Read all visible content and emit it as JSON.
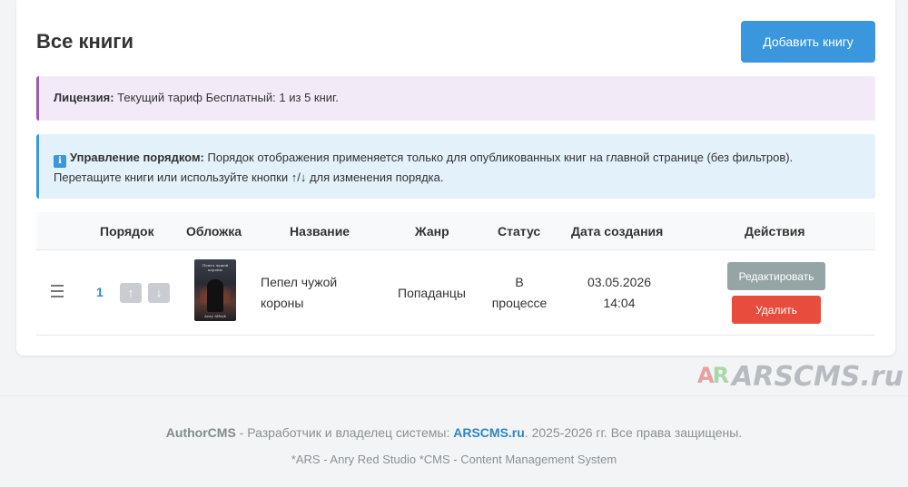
{
  "header": {
    "title": "Все книги",
    "add_button": "Добавить книгу"
  },
  "license": {
    "label": "Лицензия:",
    "text": " Текущий тариф Бесплатный: 1 из 5 книг."
  },
  "order_info": {
    "icon": "i",
    "label": "Управление порядком:",
    "text1": " Порядок отображения применяется только для опубликованных книг на главной странице (без фильтров).",
    "text2": "Перетащите книги или используйте кнопки ↑/↓ для изменения порядка."
  },
  "table": {
    "columns": [
      "Порядок",
      "Обложка",
      "Название",
      "Жанр",
      "Статус",
      "Дата создания",
      "Действия"
    ],
    "rows": [
      {
        "order": "1",
        "up": "↑",
        "down": "↓",
        "cover_caption": "Пепел чужой короны",
        "cover_author": "Аnry Аlfeyk",
        "title_line1": "Пепел чужой",
        "title_line2": "короны",
        "genre": "Попаданцы",
        "status_line1": "В",
        "status_line2": "процессе",
        "date": "03.05.2026",
        "time": "14:04",
        "edit": "Редактировать",
        "delete": "Удалить"
      }
    ]
  },
  "watermark": {
    "logo_a": "A",
    "logo_r": "R",
    "text": "ARSCMS.ru"
  },
  "footer": {
    "brand": "AuthorCMS",
    "middle": " - Разработчик и владелец системы: ",
    "link": "ARSCMS.ru",
    "tail": ". 2025-2026 гг. Все права защищены.",
    "note": "*ARS - Anry Red Studio *CMS - Content Management System"
  },
  "colors": {
    "primary": "#3a97de",
    "danger": "#e74c3c",
    "secondary": "#95a5a6",
    "license_accent": "#9b59b6"
  }
}
